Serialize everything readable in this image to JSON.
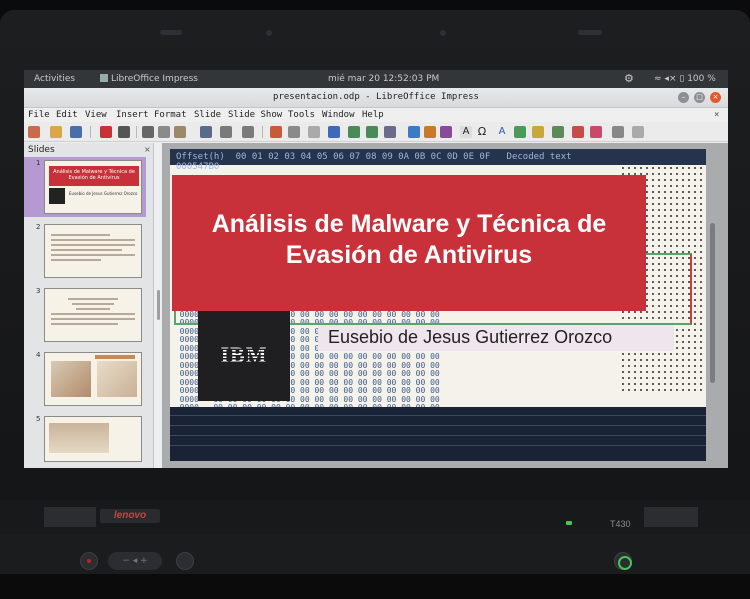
{
  "topbar": {
    "activities": "Activities",
    "task": "LibreOffice Impress",
    "clock": "mié mar 20 12:52:03 PM",
    "battery": "100 %"
  },
  "window": {
    "title": "presentacion.odp - LibreOffice Impress"
  },
  "menu": [
    "File",
    "Edit",
    "View",
    "Insert",
    "Format",
    "Slide",
    "Slide Show",
    "Tools",
    "Window",
    "Help"
  ],
  "slides_pane": {
    "title": "Slides",
    "slides": [
      {
        "num": "1",
        "title": "Análisis de Malware y Técnica de Evasión de Antivirus",
        "author": "Eusebio de Jesus Gutierrez Orozco"
      },
      {
        "num": "2"
      },
      {
        "num": "3"
      },
      {
        "num": "4"
      },
      {
        "num": "5"
      }
    ]
  },
  "slide": {
    "hex_header": "Offset(h)  00 01 02 03 04 05 06 07 08 09 0A 0B 0C 0D 0E 0F   Decoded text",
    "hex_first": "000547B0",
    "title": "Análisis de Malware y Técnica de Evasión de Antivirus",
    "logo": "IBM",
    "author": "Eusebio de Jesus Gutierrez Orozco"
  },
  "laptop": {
    "brand": "lenovo",
    "model": "T430"
  },
  "colors": {
    "title_red": "#c8313a",
    "selection": "#b49ad0"
  }
}
